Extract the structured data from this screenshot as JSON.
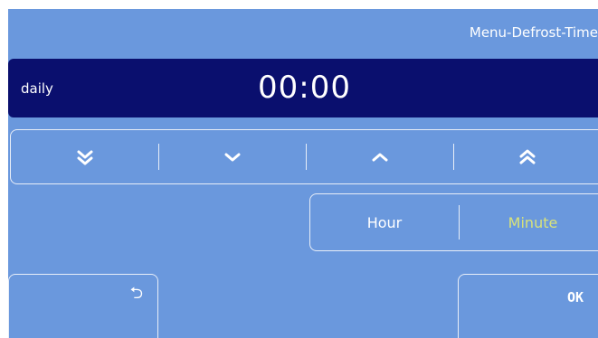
{
  "header": {
    "title": "Menu-Defrost-Time"
  },
  "time_display": {
    "mode": "daily",
    "value": "00:00"
  },
  "adjust_buttons": [
    {
      "name": "fast-decrease",
      "icon": "double-chevron-down-icon"
    },
    {
      "name": "decrease",
      "icon": "chevron-down-icon"
    },
    {
      "name": "increase",
      "icon": "chevron-up-icon"
    },
    {
      "name": "fast-increase",
      "icon": "double-chevron-up-icon"
    }
  ],
  "unit_selector": {
    "hour_label": "Hour",
    "minute_label": "Minute",
    "selected": "Minute"
  },
  "footer": {
    "back_icon": "back-arrow-icon",
    "back_glyph": "⮌",
    "ok_label": "OK"
  },
  "colors": {
    "background": "#6a98dd",
    "time_bar": "#0a0f6e",
    "selected_text": "#d8e27a",
    "text": "#ffffff"
  }
}
